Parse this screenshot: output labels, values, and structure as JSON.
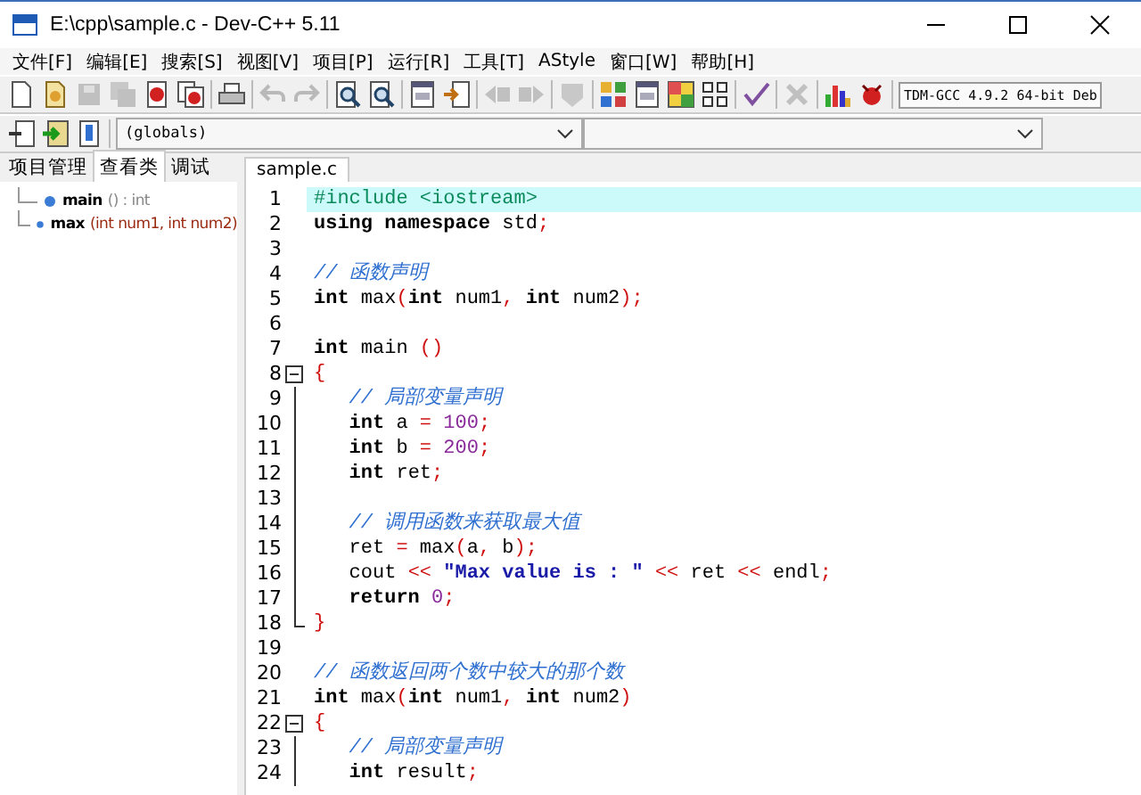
{
  "window": {
    "title": "E:\\cpp\\sample.c - Dev-C++ 5.11"
  },
  "menu": [
    "文件[F]",
    "编辑[E]",
    "搜索[S]",
    "视图[V]",
    "项目[P]",
    "运行[R]",
    "工具[T]",
    "AStyle",
    "窗口[W]",
    "帮助[H]"
  ],
  "toolbar": {
    "groups": [
      {
        "buttons": [
          {
            "disabled": false
          },
          {
            "disabled": false
          },
          {
            "disabled": true
          },
          {
            "disabled": true
          },
          {
            "disabled": false
          },
          {
            "disabled": false
          }
        ]
      },
      {
        "buttons": [
          {
            "disabled": false
          }
        ]
      },
      {
        "buttons": [
          {
            "disabled": true
          },
          {
            "disabled": true
          }
        ]
      },
      {
        "buttons": [
          {
            "disabled": false
          },
          {
            "disabled": false
          }
        ]
      },
      {
        "buttons": [
          {
            "disabled": false
          },
          {
            "disabled": false
          }
        ]
      },
      {
        "buttons": [
          {
            "disabled": true
          },
          {
            "disabled": true
          }
        ]
      },
      {
        "buttons": [
          {
            "disabled": true
          }
        ]
      },
      {
        "buttons": [
          {
            "disabled": false
          },
          {
            "disabled": false
          },
          {
            "disabled": false
          },
          {
            "disabled": false
          }
        ]
      },
      {
        "buttons": [
          {
            "disabled": false
          }
        ]
      },
      {
        "buttons": [
          {
            "disabled": true
          }
        ]
      },
      {
        "buttons": [
          {
            "disabled": false
          },
          {
            "disabled": false
          }
        ]
      }
    ],
    "compiler": "TDM-GCC 4.9.2 64-bit Deb"
  },
  "toolbar2": {
    "scope": "(globals)"
  },
  "left_tabs": [
    {
      "label": "项目管理",
      "selected": false
    },
    {
      "label": "查看类",
      "selected": true
    },
    {
      "label": "调试",
      "selected": false
    }
  ],
  "class_tree": [
    {
      "name": "main",
      "signature": "() : int",
      "kind": "plain"
    },
    {
      "name": "max",
      "signature": "(int num1, int num2)",
      "kind": "params"
    }
  ],
  "editor_tabs": [
    {
      "label": "sample.c",
      "selected": true
    }
  ],
  "lines": [
    {
      "number": "1",
      "current": true,
      "tokens": [
        {
          "kind": "pre",
          "text": "#include <iostream>"
        }
      ]
    },
    {
      "number": "2",
      "current": false,
      "tokens": [
        {
          "kind": "kw",
          "text": "using "
        },
        {
          "kind": "kw",
          "text": "namespace "
        },
        {
          "kind": "plain",
          "text": "std"
        },
        {
          "kind": "sym",
          "text": ";"
        }
      ]
    },
    {
      "number": "3",
      "current": false
    },
    {
      "number": "4",
      "current": false,
      "tokens": [
        {
          "kind": "cmt",
          "text": "// 函数声明"
        }
      ]
    },
    {
      "number": "5",
      "current": false,
      "tokens": [
        {
          "kind": "kw",
          "text": "int "
        },
        {
          "kind": "plain",
          "text": "max"
        },
        {
          "kind": "sym",
          "text": "("
        },
        {
          "kind": "kw",
          "text": "int "
        },
        {
          "kind": "plain",
          "text": "num1"
        },
        {
          "kind": "sym",
          "text": ", "
        },
        {
          "kind": "kw",
          "text": "int "
        },
        {
          "kind": "plain",
          "text": "num2"
        },
        {
          "kind": "sym",
          "text": ");"
        }
      ]
    },
    {
      "number": "6",
      "current": false
    },
    {
      "number": "7",
      "current": false,
      "tokens": [
        {
          "kind": "kw",
          "text": "int "
        },
        {
          "kind": "plain",
          "text": "main "
        },
        {
          "kind": "sym",
          "text": "()"
        }
      ]
    },
    {
      "number": "8",
      "current": false,
      "kind": "fold_start",
      "tokens": [
        {
          "kind": "sym",
          "text": "{"
        }
      ]
    },
    {
      "number": "9",
      "current": false,
      "kind": "fold_body",
      "tokens": [
        {
          "kind": "cmt",
          "text": "   // 局部变量声明"
        }
      ]
    },
    {
      "number": "10",
      "current": false,
      "kind": "fold_body",
      "tokens": [
        {
          "kind": "kw",
          "text": "   int "
        },
        {
          "kind": "plain",
          "text": "a "
        },
        {
          "kind": "sym",
          "text": "= "
        },
        {
          "kind": "num",
          "text": "100"
        },
        {
          "kind": "sym",
          "text": ";"
        }
      ]
    },
    {
      "number": "11",
      "current": false,
      "kind": "fold_body",
      "tokens": [
        {
          "kind": "kw",
          "text": "   int "
        },
        {
          "kind": "plain",
          "text": "b "
        },
        {
          "kind": "sym",
          "text": "= "
        },
        {
          "kind": "num",
          "text": "200"
        },
        {
          "kind": "sym",
          "text": ";"
        }
      ]
    },
    {
      "number": "12",
      "current": false,
      "kind": "fold_body",
      "tokens": [
        {
          "kind": "kw",
          "text": "   int "
        },
        {
          "kind": "plain",
          "text": "ret"
        },
        {
          "kind": "sym",
          "text": ";"
        }
      ]
    },
    {
      "number": "13",
      "current": false,
      "kind": "fold_body"
    },
    {
      "number": "14",
      "current": false,
      "kind": "fold_body",
      "tokens": [
        {
          "kind": "cmt",
          "text": "   // 调用函数来获取最大值"
        }
      ]
    },
    {
      "number": "15",
      "current": false,
      "kind": "fold_body",
      "tokens": [
        {
          "kind": "plain",
          "text": "   ret "
        },
        {
          "kind": "sym",
          "text": "= "
        },
        {
          "kind": "plain",
          "text": "max"
        },
        {
          "kind": "sym",
          "text": "("
        },
        {
          "kind": "plain",
          "text": "a"
        },
        {
          "kind": "sym",
          "text": ", "
        },
        {
          "kind": "plain",
          "text": "b"
        },
        {
          "kind": "sym",
          "text": ");"
        }
      ]
    },
    {
      "number": "16",
      "current": false,
      "kind": "fold_body",
      "tokens": [
        {
          "kind": "plain",
          "text": "   cout "
        },
        {
          "kind": "sym",
          "text": "<< "
        },
        {
          "kind": "str",
          "text": "\"Max value is : \" "
        },
        {
          "kind": "sym",
          "text": "<< "
        },
        {
          "kind": "plain",
          "text": "ret "
        },
        {
          "kind": "sym",
          "text": "<< "
        },
        {
          "kind": "plain",
          "text": "endl"
        },
        {
          "kind": "sym",
          "text": ";"
        }
      ]
    },
    {
      "number": "17",
      "current": false,
      "kind": "fold_body",
      "tokens": [
        {
          "kind": "kw",
          "text": "   return "
        },
        {
          "kind": "num",
          "text": "0"
        },
        {
          "kind": "sym",
          "text": ";"
        }
      ]
    },
    {
      "number": "18",
      "current": false,
      "kind": "fold_end",
      "tokens": [
        {
          "kind": "sym",
          "text": "}"
        }
      ]
    },
    {
      "number": "19",
      "current": false
    },
    {
      "number": "20",
      "current": false,
      "tokens": [
        {
          "kind": "cmt",
          "text": "// 函数返回两个数中较大的那个数"
        }
      ]
    },
    {
      "number": "21",
      "current": false,
      "tokens": [
        {
          "kind": "kw",
          "text": "int "
        },
        {
          "kind": "plain",
          "text": "max"
        },
        {
          "kind": "sym",
          "text": "("
        },
        {
          "kind": "kw",
          "text": "int "
        },
        {
          "kind": "plain",
          "text": "num1"
        },
        {
          "kind": "sym",
          "text": ", "
        },
        {
          "kind": "kw",
          "text": "int "
        },
        {
          "kind": "plain",
          "text": "num2"
        },
        {
          "kind": "sym",
          "text": ")"
        }
      ]
    },
    {
      "number": "22",
      "current": false,
      "kind": "fold_start",
      "tokens": [
        {
          "kind": "sym",
          "text": "{"
        }
      ]
    },
    {
      "number": "23",
      "current": false,
      "kind": "fold_body",
      "tokens": [
        {
          "kind": "cmt",
          "text": "   // 局部变量声明"
        }
      ]
    },
    {
      "number": "24",
      "current": false,
      "kind": "fold_body",
      "tokens": [
        {
          "kind": "kw",
          "text": "   int "
        },
        {
          "kind": "plain",
          "text": "result"
        },
        {
          "kind": "sym",
          "text": ";"
        }
      ]
    }
  ]
}
